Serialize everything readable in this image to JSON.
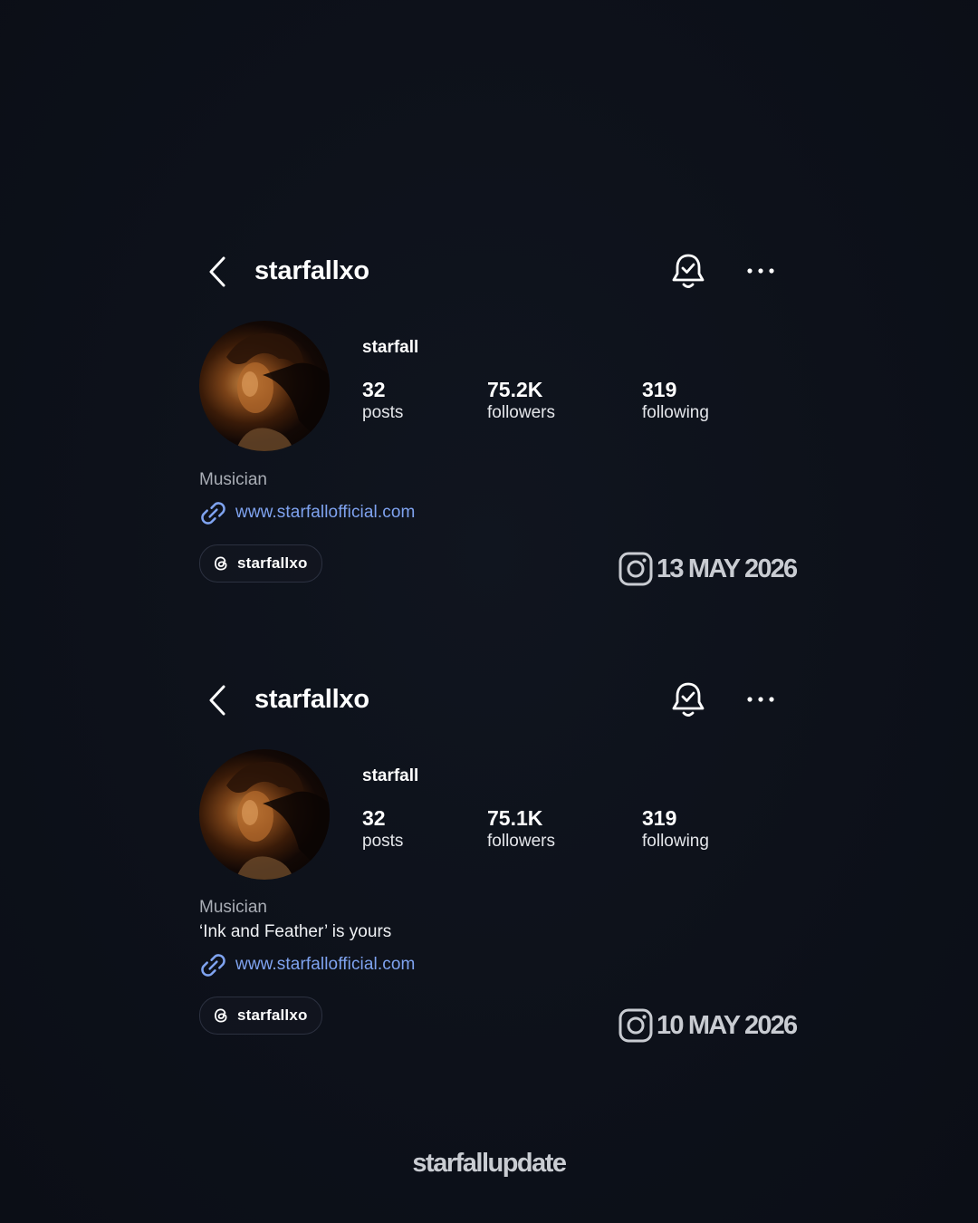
{
  "cards": [
    {
      "header": {
        "username": "starfallxo"
      },
      "profile": {
        "display_name": "starfall",
        "stats": {
          "posts_count": "32",
          "posts_label": "posts",
          "followers_count": "75.2K",
          "followers_label": "followers",
          "following_count": "319",
          "following_label": "following"
        },
        "category": "Musician",
        "bio": "",
        "link": "www.starfallofficial.com",
        "threads_handle": "starfallxo"
      },
      "date": "13 MAY 2026"
    },
    {
      "header": {
        "username": "starfallxo"
      },
      "profile": {
        "display_name": "starfall",
        "stats": {
          "posts_count": "32",
          "posts_label": "posts",
          "followers_count": "75.1K",
          "followers_label": "followers",
          "following_count": "319",
          "following_label": "following"
        },
        "category": "Musician",
        "bio": "‘Ink and Feather’ is yours",
        "link": "www.starfallofficial.com",
        "threads_handle": "starfallxo"
      },
      "date": "10 MAY 2026"
    }
  ],
  "footer": {
    "handle": "starfallupdate"
  },
  "colors": {
    "background": "#0d111a",
    "link": "#7fa3f0",
    "muted_text": "#a9adb5",
    "stamp_text": "#c9ccd2"
  },
  "icons": [
    "chevron-left-icon",
    "bell-check-icon",
    "more-horizontal-icon",
    "link-icon",
    "threads-icon",
    "instagram-icon"
  ]
}
